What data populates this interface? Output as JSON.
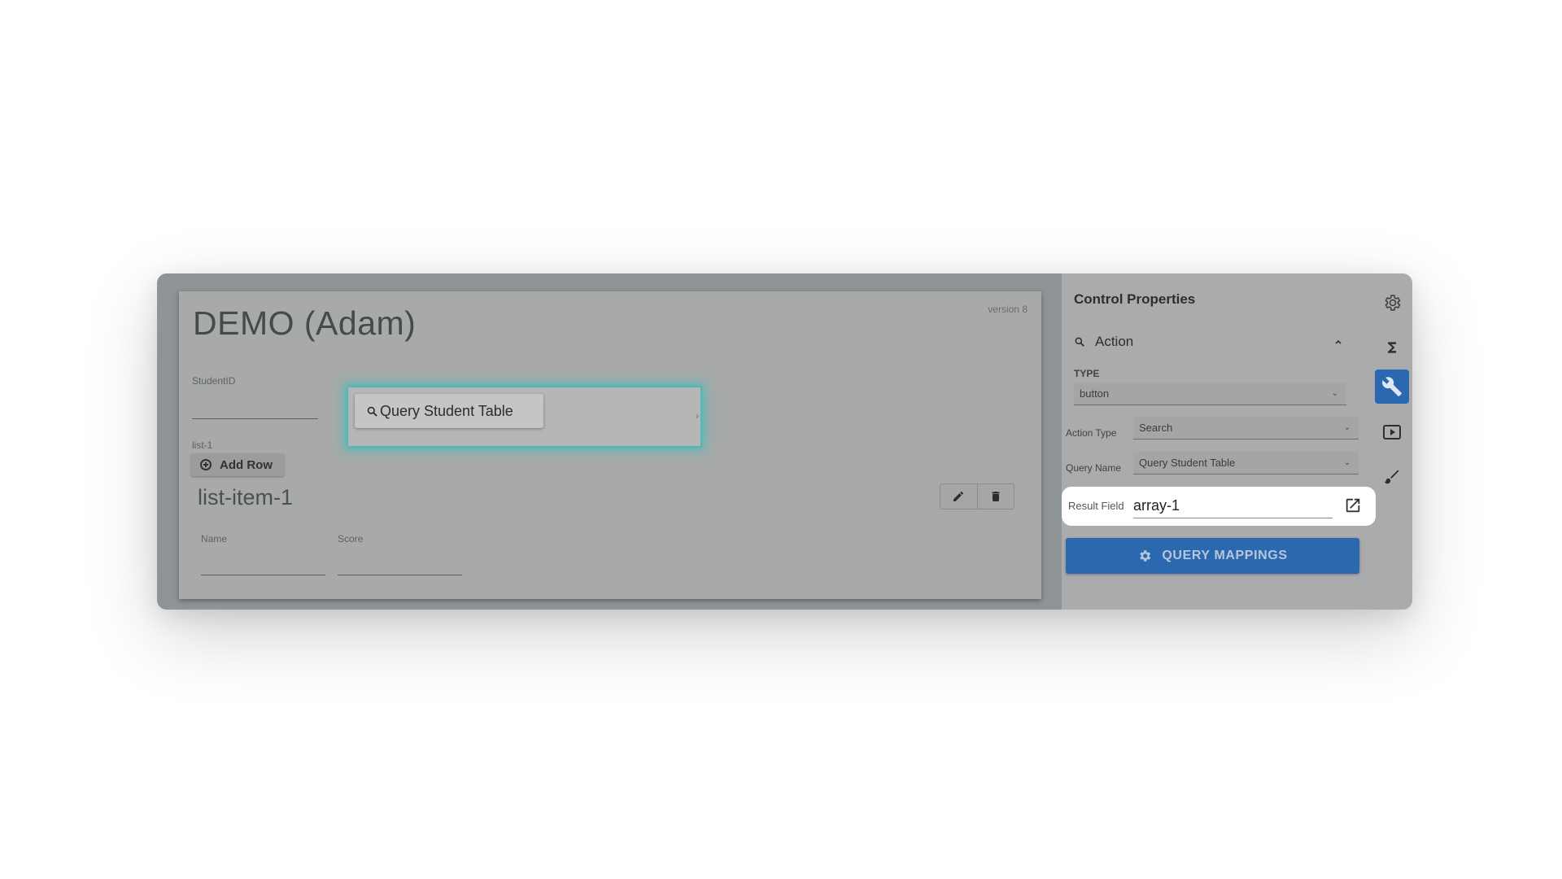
{
  "form": {
    "title": "DEMO (Adam)",
    "version": "version 8",
    "student_id_label": "StudentID",
    "list_label": "list-1",
    "add_row_label": "Add Row",
    "list_item_title": "list-item-1",
    "columns": [
      "Name",
      "Score"
    ]
  },
  "popup": {
    "button_label": "Query Student Table",
    "chevron": "›"
  },
  "props": {
    "title": "Control Properties",
    "section": "Action",
    "type_label": "TYPE",
    "type_value": "button",
    "action_type_label": "Action Type",
    "action_type_value": "Search",
    "query_name_label": "Query Name",
    "query_name_value": "Query Student Table",
    "result_field_label": "Result Field",
    "result_field_value": "array-1",
    "query_mappings_label": "QUERY MAPPINGS"
  },
  "rail": {
    "icons": [
      "gear-icon",
      "sigma-icon",
      "wrench-icon",
      "play-icon",
      "brush-icon"
    ],
    "active": "wrench-icon"
  },
  "colors": {
    "accent": "#2a68b0",
    "highlight_glow": "#28c8c8"
  }
}
